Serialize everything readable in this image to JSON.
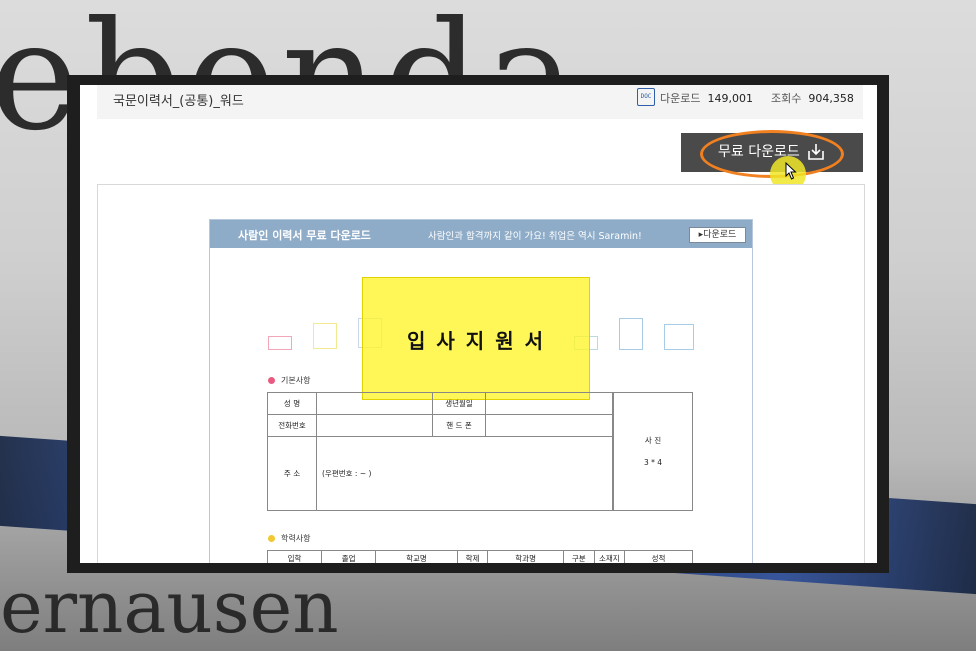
{
  "background": {
    "top_text": "ebenda",
    "bottom_text": "ernausen"
  },
  "header": {
    "doc_title": "국문이력서_(공통)_워드",
    "file_icon": "docx-icon",
    "downloads_label": "다운로드",
    "downloads_count": "149,001",
    "views_label": "조회수",
    "views_count": "904,358"
  },
  "download_button": {
    "label": "무료 다운로드",
    "icon": "download-icon"
  },
  "preview": {
    "banner_title": "사람인 이력서 무료 다운로드",
    "banner_subtitle": "사람인과 합격까지 같이 가요! 취업은 역시 Saramin!",
    "banner_button": "▸다운로드",
    "form_title": "입사지원서",
    "section_basic": "기본사항",
    "section_education": "학력사항",
    "basic_table": {
      "name": "성    명",
      "birth": "생년월일",
      "phone": "전화번호",
      "mobile": "핸 드 폰",
      "address": "주    소",
      "postal": "(우편번호 :          ~        )",
      "photo": "사    진",
      "photo_size": "3 * 4"
    },
    "education_headers": [
      "입학",
      "졸업",
      "학교명",
      "학제",
      "학과명",
      "구분",
      "소재지",
      "성적"
    ]
  },
  "colors": {
    "ring": "#f08020",
    "highlight": "#fff528",
    "banner": "#8eacc8"
  }
}
